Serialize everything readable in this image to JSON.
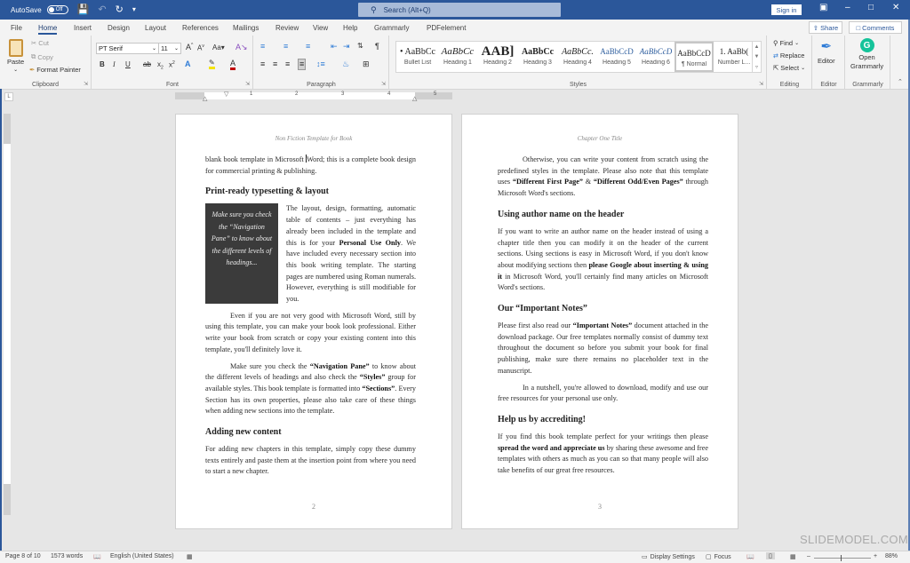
{
  "titlebar": {
    "autosave_label": "AutoSave",
    "autosave_state": "Off",
    "search_placeholder": "Search (Alt+Q)",
    "signin_label": "Sign in"
  },
  "tabs": [
    {
      "label": "File"
    },
    {
      "label": "Home",
      "active": true
    },
    {
      "label": "Insert"
    },
    {
      "label": "Design"
    },
    {
      "label": "Layout"
    },
    {
      "label": "References"
    },
    {
      "label": "Mailings"
    },
    {
      "label": "Review"
    },
    {
      "label": "View"
    },
    {
      "label": "Help"
    },
    {
      "label": "Grammarly"
    },
    {
      "label": "PDFelement"
    }
  ],
  "actions": {
    "share": "Share",
    "comments": "Comments"
  },
  "ribbon": {
    "clipboard": {
      "label": "Clipboard",
      "paste": "Paste",
      "cut": "Cut",
      "copy": "Copy",
      "format_painter": "Format Painter"
    },
    "font": {
      "label": "Font",
      "font_name": "PT Serif",
      "font_size": "11",
      "highlight_color": "#f5e400",
      "font_color": "#c00000"
    },
    "paragraph": {
      "label": "Paragraph"
    },
    "styles": {
      "label": "Styles",
      "items": [
        {
          "preview": "• AaBbCc",
          "label": "Bullet List"
        },
        {
          "preview": "AaBbCc",
          "label": "Heading 1"
        },
        {
          "preview": "AAB]",
          "label": "Heading 2"
        },
        {
          "preview": "AaBbCc",
          "label": "Heading 3"
        },
        {
          "preview": "AaBbCc.",
          "label": "Heading 4"
        },
        {
          "preview": "AaBbCcD",
          "label": "Heading 5"
        },
        {
          "preview": "AaBbCcD",
          "label": "Heading 6"
        },
        {
          "preview": "AaBbCcD",
          "label": "¶ Normal",
          "selected": true
        },
        {
          "preview": "1. AaBb(",
          "label": "Number L..."
        }
      ]
    },
    "editing": {
      "label": "Editing",
      "find": "Find",
      "replace": "Replace",
      "select": "Select"
    },
    "editor": {
      "label": "Editor",
      "button": "Editor"
    },
    "grammarly": {
      "label": "Grammarly",
      "button_line1": "Open",
      "button_line2": "Grammarly"
    }
  },
  "ruler": {
    "numbers": [
      "1",
      "2",
      "3",
      "4",
      "5"
    ]
  },
  "pages": [
    {
      "header": "Non Fiction Template for Book",
      "number": "2",
      "p1_a": "blank book template in Microsoft ",
      "p1_b": "Word; this is a complete book design for commercial printing & publishing.",
      "h1": "Print-ready typesetting & layout",
      "callout": "Make sure you check the “Navigation Pane” to know about the different levels of headings...",
      "p2_a": "The layout, design, formatting, automatic table of contents – just everything has already been included in the template and this is for your ",
      "p2_b": "Personal Use Only",
      "p2_c": ". We have included every necessary section into this book writing template. The starting pages are numbered using Roman numerals. However, everything is still modifiable for you.",
      "p3": "Even if you are not very good with Microsoft Word, still by using this template, you can make your book look professional. Either write your book from scratch or copy your existing content into this template, you'll definitely love it.",
      "p4_a": "Make sure you check the ",
      "p4_b": "“Navigation Pane”",
      "p4_c": " to know about the different levels of headings and also check the ",
      "p4_d": "“Styles”",
      "p4_e": " group for available styles. This book template is formatted into ",
      "p4_f": "“Sections”",
      "p4_g": ". Every Section has its own properties, please also take care of these things when adding new sections into the template.",
      "h2": "Adding new content",
      "p5": "For adding new chapters in this template, simply copy these dummy texts entirely and paste them at the insertion point from where you need to start a new chapter."
    },
    {
      "header": "Chapter One Title",
      "number": "3",
      "p1_a": "Otherwise, you can write your content from scratch using the predefined styles in the template. Please also note that this template uses ",
      "p1_b": "“Different First Page”",
      "p1_c": " & ",
      "p1_d": "“Different Odd/Even Pages”",
      "p1_e": " through Microsoft Word's sections.",
      "h1": "Using author name on the header",
      "p2_a": "If you want to write an author name on the header instead of using a chapter title then you can modify it on the header of the current sections. Using sections is easy in Microsoft Word, if you don't know about modifying sections then ",
      "p2_b": "please Google about inserting & using it",
      "p2_c": " in Microsoft Word, you'll certainly find many articles on Microsoft Word's sections.",
      "h2": "Our “Important Notes”",
      "p3_a": "Please first also read our ",
      "p3_b": "“Important Notes”",
      "p3_c": " document attached in the download package. Our free templates normally consist of dummy text throughout the document so before you submit your book for final publishing, make sure there remains no placeholder text in the manuscript.",
      "p4": "In a nutshell, you're allowed to download, modify and use our free resources for your personal use only.",
      "h3": "Help us by accrediting!",
      "p5_a": "If you find this book template perfect for your writings then please ",
      "p5_b": "spread the word and appreciate us",
      "p5_c": " by sharing these awesome and free templates with others as much as you can so that many people will also take benefits of our great free resources."
    }
  ],
  "statusbar": {
    "page": "Page 8 of 10",
    "words": "1573 words",
    "language": "English (United States)",
    "display_settings": "Display Settings",
    "focus": "Focus",
    "zoom": "88%"
  },
  "watermark": "SLIDEMODEL.COM"
}
